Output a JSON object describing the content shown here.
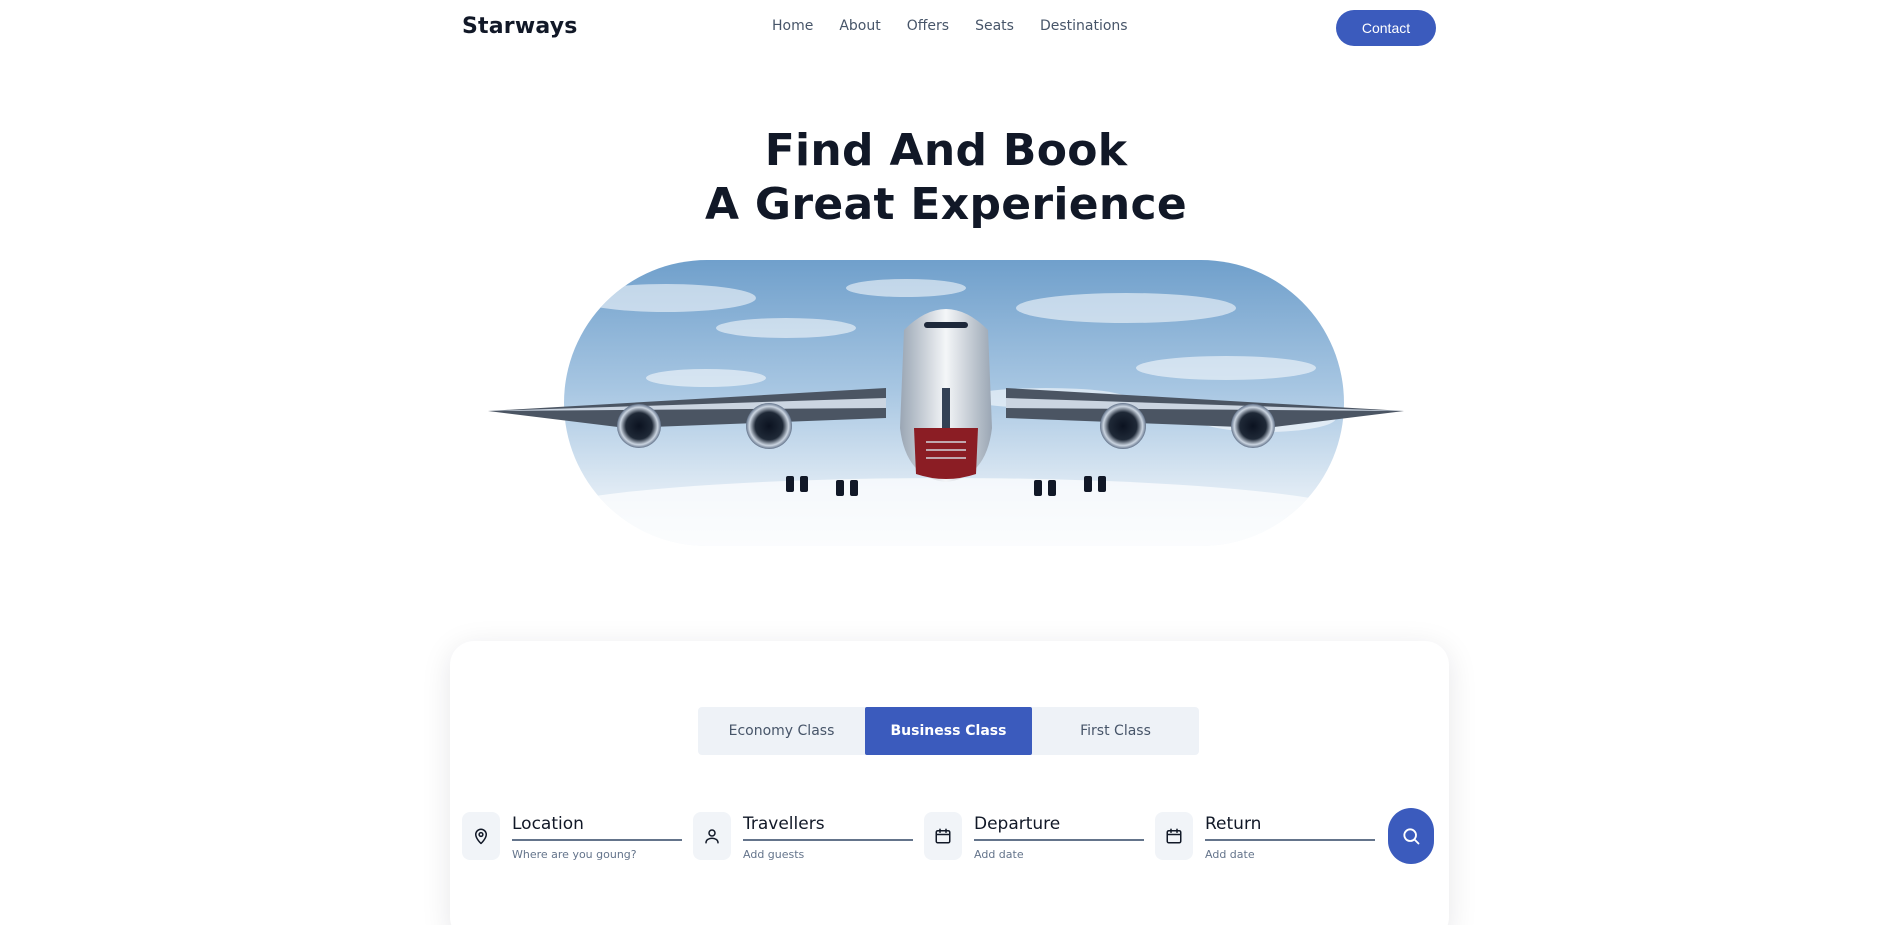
{
  "nav": {
    "logo": "Starways",
    "links": [
      "Home",
      "About",
      "Offers",
      "Seats",
      "Destinations"
    ],
    "contact_label": "Contact"
  },
  "hero": {
    "title_line1": "Find And Book",
    "title_line2": "A Great Experience"
  },
  "booking": {
    "tabs": [
      "Economy Class",
      "Business Class",
      "First Class"
    ],
    "active_tab": "Business Class",
    "fields": [
      {
        "label": "Location",
        "sub": "Where are you goung?",
        "icon": "location-pin-icon"
      },
      {
        "label": "Travellers",
        "sub": "Add guests",
        "icon": "user-icon"
      },
      {
        "label": "Departure",
        "sub": "Add date",
        "icon": "calendar-icon"
      },
      {
        "label": "Return",
        "sub": "Add date",
        "icon": "calendar-icon"
      }
    ],
    "search_icon": "search-icon"
  },
  "colors": {
    "accent": "#3b5bbd",
    "heading": "#111827",
    "muted": "#475569"
  }
}
